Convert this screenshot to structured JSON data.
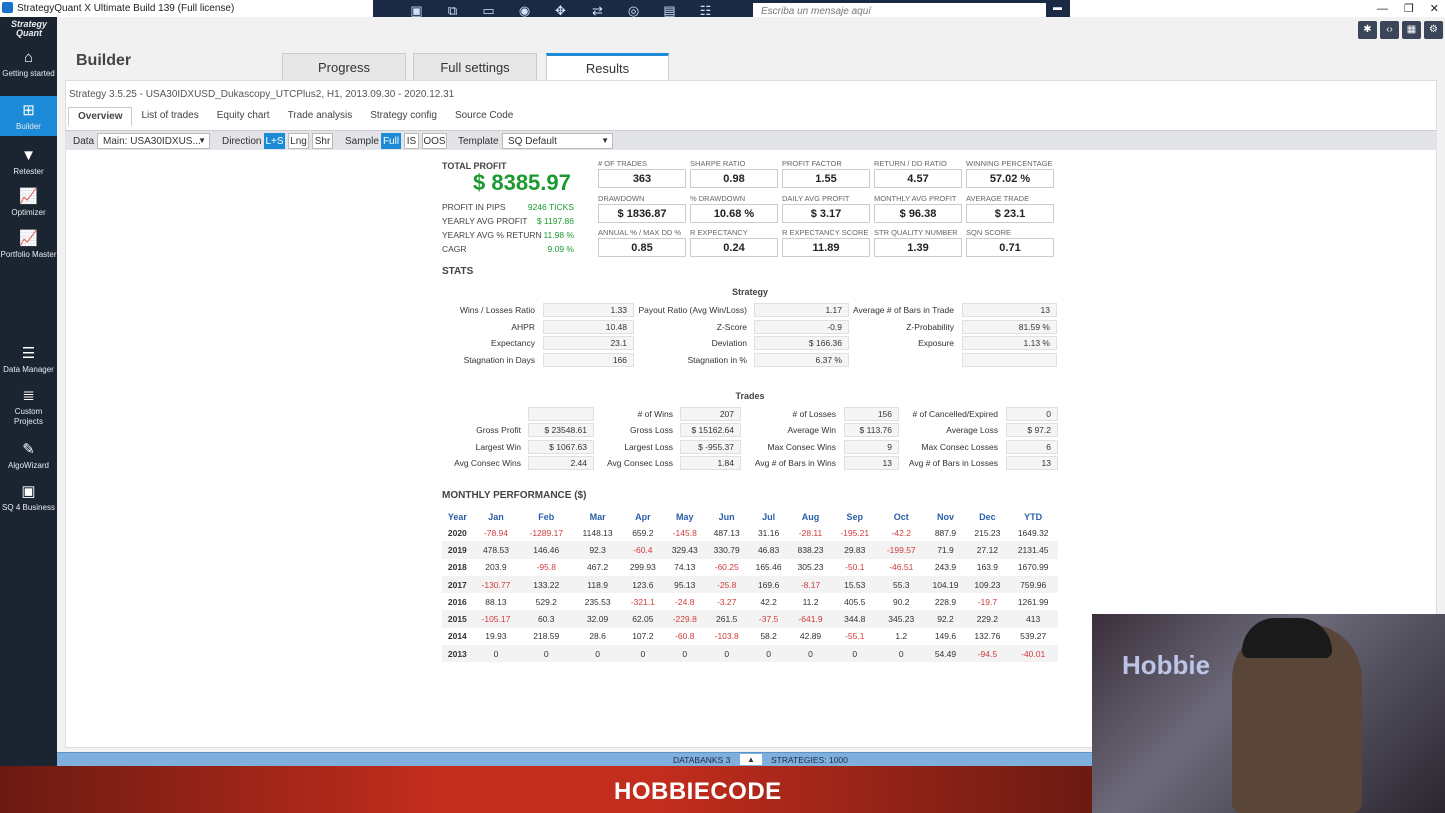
{
  "window": {
    "title": "StrategyQuant X Ultimate Build 139 (Full license)",
    "minimize": "—",
    "restore": "❐",
    "close": "✕"
  },
  "teamviewer": {
    "message_placeholder": "Escriba un mensaje aquí"
  },
  "sidebar": {
    "brand": "Strategy Quant",
    "items": [
      {
        "label": "Getting started",
        "icon": "home-icon",
        "glyph": "⌂"
      },
      {
        "label": "Builder",
        "icon": "plus-icon",
        "glyph": "⊞"
      },
      {
        "label": "Retester",
        "icon": "filter-icon",
        "glyph": "▼"
      },
      {
        "label": "Optimizer",
        "icon": "chart-icon",
        "glyph": "📈"
      },
      {
        "label": "Portfolio Master",
        "icon": "chart-icon",
        "glyph": "📈"
      },
      {
        "label": "Data Manager",
        "icon": "database-icon",
        "glyph": "☰"
      },
      {
        "label": "Custom Projects",
        "icon": "list-icon",
        "glyph": "≣"
      },
      {
        "label": "AlgoWizard",
        "icon": "wand-icon",
        "glyph": "✎"
      },
      {
        "label": "SQ 4 Business",
        "icon": "briefcase-icon",
        "glyph": "▣"
      }
    ]
  },
  "header": {
    "title": "Builder",
    "tabs": [
      "Progress",
      "Full settings",
      "Results"
    ]
  },
  "strategy_info": "Strategy 3.5.25 - USA30IDXUSD_Dukascopy_UTCPlus2, H1, 2013.09.30 - 2020.12.31",
  "subtabs": [
    "Overview",
    "List of trades",
    "Equity chart",
    "Trade analysis",
    "Strategy config",
    "Source Code"
  ],
  "filters": {
    "data_label": "Data",
    "data_value": "Main: USA30IDXUS...",
    "direction_label": "Direction",
    "direction_options": [
      "L+S",
      "Lng",
      "Shr"
    ],
    "sample_label": "Sample",
    "sample_options": [
      "Full",
      "IS",
      "OOS"
    ],
    "template_label": "Template",
    "template_value": "SQ Default"
  },
  "summary": {
    "total_profit_label": "TOTAL PROFIT",
    "total_profit": "$ 8385.97",
    "kpis": [
      {
        "label": "PROFIT IN PIPS",
        "value": "9246 TICKS"
      },
      {
        "label": "YEARLY AVG PROFIT",
        "value": "$ 1197.86"
      },
      {
        "label": "YEARLY AVG % RETURN",
        "value": "11.98 %"
      },
      {
        "label": "CAGR",
        "value": "9.09 %"
      }
    ],
    "metrics": [
      {
        "label": "# OF TRADES",
        "value": "363"
      },
      {
        "label": "SHARPE RATIO",
        "value": "0.98"
      },
      {
        "label": "PROFIT FACTOR",
        "value": "1.55"
      },
      {
        "label": "RETURN / DD RATIO",
        "value": "4.57"
      },
      {
        "label": "WINNING PERCENTAGE",
        "value": "57.02 %"
      },
      {
        "label": "DRAWDOWN",
        "value": "$ 1836.87"
      },
      {
        "label": "% DRAWDOWN",
        "value": "10.68 %"
      },
      {
        "label": "DAILY AVG PROFIT",
        "value": "$ 3.17"
      },
      {
        "label": "MONTHLY AVG PROFIT",
        "value": "$ 96.38"
      },
      {
        "label": "AVERAGE TRADE",
        "value": "$ 23.1"
      },
      {
        "label": "ANNUAL % / MAX DD %",
        "value": "0.85"
      },
      {
        "label": "R EXPECTANCY",
        "value": "0.24"
      },
      {
        "label": "R EXPECTANCY SCORE",
        "value": "11.89"
      },
      {
        "label": "STR QUALITY NUMBER",
        "value": "1.39"
      },
      {
        "label": "SQN SCORE",
        "value": "0.71"
      }
    ]
  },
  "stats": {
    "heading": "STATS",
    "strategy_title": "Strategy",
    "strategy": [
      {
        "label": "Wins / Losses Ratio",
        "value": "1.33"
      },
      {
        "label": "Payout Ratio (Avg Win/Loss)",
        "value": "1.17"
      },
      {
        "label": "Average # of Bars in Trade",
        "value": "13"
      },
      {
        "label": "AHPR",
        "value": "10.48"
      },
      {
        "label": "Z-Score",
        "value": "-0.9"
      },
      {
        "label": "Z-Probability",
        "value": "81.59 %"
      },
      {
        "label": "Expectancy",
        "value": "23.1"
      },
      {
        "label": "Deviation",
        "value": "$ 166.36"
      },
      {
        "label": "Exposure",
        "value": "1.13 %"
      },
      {
        "label": "Stagnation in Days",
        "value": "166"
      },
      {
        "label": "Stagnation in %",
        "value": "6.37 %"
      },
      {
        "label": "",
        "value": ""
      }
    ],
    "trades_title": "Trades",
    "trades": [
      {
        "label": "",
        "value": ""
      },
      {
        "label": "# of Wins",
        "value": "207"
      },
      {
        "label": "# of Losses",
        "value": "156"
      },
      {
        "label": "# of Cancelled/Expired",
        "value": "0"
      },
      {
        "label": "Gross Profit",
        "value": "$ 23548.61"
      },
      {
        "label": "Gross Loss",
        "value": "$ 15162.64"
      },
      {
        "label": "Average Win",
        "value": "$ 113.76"
      },
      {
        "label": "Average Loss",
        "value": "$ 97.2"
      },
      {
        "label": "Largest Win",
        "value": "$ 1067.63"
      },
      {
        "label": "Largest Loss",
        "value": "$ -955.37"
      },
      {
        "label": "Max Consec Wins",
        "value": "9"
      },
      {
        "label": "Max Consec Losses",
        "value": "6"
      },
      {
        "label": "Avg Consec Wins",
        "value": "2.44"
      },
      {
        "label": "Avg Consec Loss",
        "value": "1.84"
      },
      {
        "label": "Avg # of Bars in Wins",
        "value": "13"
      },
      {
        "label": "Avg # of Bars in Losses",
        "value": "13"
      }
    ]
  },
  "monthly": {
    "heading": "MONTHLY PERFORMANCE ($)",
    "columns": [
      "Year",
      "Jan",
      "Feb",
      "Mar",
      "Apr",
      "May",
      "Jun",
      "Jul",
      "Aug",
      "Sep",
      "Oct",
      "Nov",
      "Dec",
      "YTD"
    ],
    "rows": [
      [
        "2020",
        "-78.94",
        "-1289.17",
        "1148.13",
        "659.2",
        "-145.8",
        "487.13",
        "31.16",
        "-28.11",
        "-195.21",
        "-42.2",
        "887.9",
        "215.23",
        "1649.32"
      ],
      [
        "2019",
        "478.53",
        "146.46",
        "92.3",
        "-60.4",
        "329.43",
        "330.79",
        "46.83",
        "838.23",
        "29.83",
        "-199.57",
        "71.9",
        "27.12",
        "2131.45"
      ],
      [
        "2018",
        "203.9",
        "-95.8",
        "467.2",
        "299.93",
        "74.13",
        "-60.25",
        "165.46",
        "305.23",
        "-50.1",
        "-46.51",
        "243.9",
        "163.9",
        "1670.99"
      ],
      [
        "2017",
        "-130.77",
        "133.22",
        "118.9",
        "123.6",
        "95.13",
        "-25.8",
        "169.6",
        "-8.17",
        "15.53",
        "55.3",
        "104.19",
        "109.23",
        "759.96"
      ],
      [
        "2016",
        "88.13",
        "529.2",
        "235.53",
        "-321.1",
        "-24.8",
        "-3.27",
        "42.2",
        "11.2",
        "405.5",
        "90.2",
        "228.9",
        "-19.7",
        "1261.99"
      ],
      [
        "2015",
        "-105.17",
        "60.3",
        "32.09",
        "62.05",
        "-229.8",
        "261.5",
        "-37.5",
        "-641.9",
        "344.8",
        "345.23",
        "92.2",
        "229.2",
        "413"
      ],
      [
        "2014",
        "19.93",
        "218.59",
        "28.6",
        "107.2",
        "-60.8",
        "-103.8",
        "58.2",
        "42.89",
        "-55.1",
        "1.2",
        "149.6",
        "132.76",
        "539.27"
      ],
      [
        "2013",
        "0",
        "0",
        "0",
        "0",
        "0",
        "0",
        "0",
        "0",
        "0",
        "0",
        "54.49",
        "-94.5",
        "-40.01"
      ]
    ]
  },
  "statusbar": {
    "databanks": "DATABANKS 3",
    "strategies": "STRATEGIES: 1000"
  },
  "banner": {
    "logo_text": "HOBBIECODE"
  },
  "webcam": {
    "neon_text": "Hobbie"
  }
}
